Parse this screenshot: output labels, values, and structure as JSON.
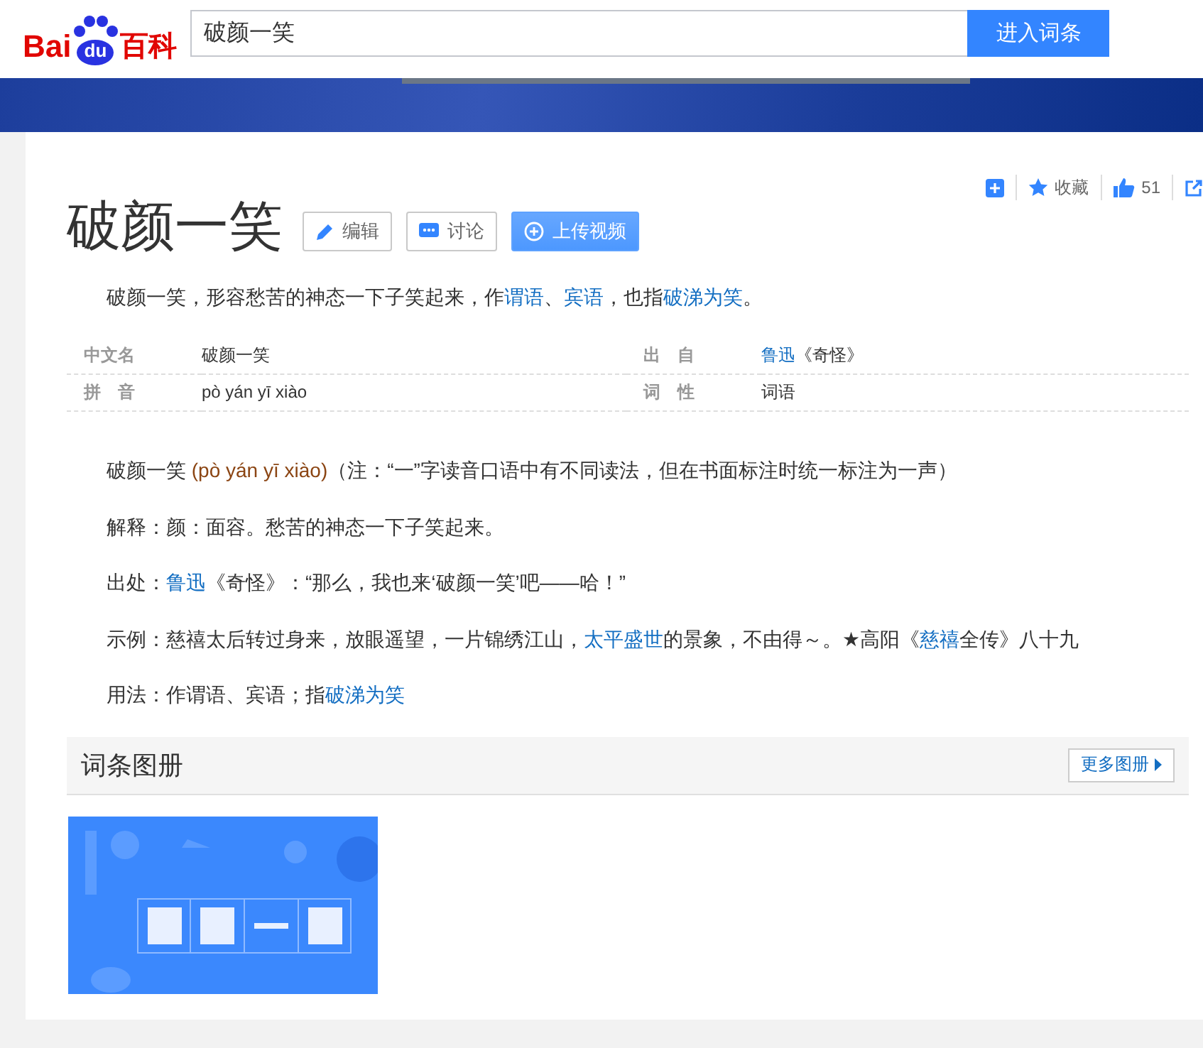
{
  "header": {
    "logo": {
      "latin": "Bai",
      "paw": "du",
      "cjk": "百科"
    },
    "search": {
      "value": "破颜一笑"
    },
    "search_button": "进入词条"
  },
  "toolbar": {
    "favorite": "收藏",
    "likes": "51"
  },
  "title": "破颜一笑",
  "title_buttons": [
    {
      "kind": "edit",
      "label": "编辑"
    },
    {
      "kind": "discuss",
      "label": "讨论"
    },
    {
      "kind": "upload",
      "label": "上传视频"
    }
  ],
  "summary": [
    {
      "kind": "plain",
      "text": "破颜一笑，形容愁苦的神态一下子笑起来，作"
    },
    {
      "kind": "link",
      "text": "谓语"
    },
    {
      "kind": "plain",
      "text": "、"
    },
    {
      "kind": "link",
      "text": "宾语"
    },
    {
      "kind": "plain",
      "text": "，也指"
    },
    {
      "kind": "link",
      "text": "破涕为笑"
    },
    {
      "kind": "plain",
      "text": "。"
    }
  ],
  "basic_info": [
    {
      "label": "中文名",
      "value": [
        {
          "kind": "plain",
          "text": "破颜一笑"
        }
      ]
    },
    {
      "label": "出　自",
      "value": [
        {
          "kind": "link",
          "text": "鲁迅"
        },
        {
          "kind": "plain",
          "text": "《奇怪》"
        }
      ]
    },
    {
      "label": "拼　音",
      "value": [
        {
          "kind": "plain",
          "text": "pò yán yī xiào"
        }
      ]
    },
    {
      "label": "词　性",
      "value": [
        {
          "kind": "plain",
          "text": "词语"
        }
      ]
    }
  ],
  "paragraphs": [
    [
      {
        "kind": "plain",
        "text": "破颜一笑 "
      },
      {
        "kind": "pinyin",
        "text": "(pò yán yī xiào)"
      },
      {
        "kind": "plain",
        "text": "（注：“一”字读音口语中有不同读法，但在书面标注时统一标注为一声）"
      }
    ],
    [
      {
        "kind": "plain",
        "text": "解释：颜：面容。愁苦的神态一下子笑起来。"
      }
    ],
    [
      {
        "kind": "plain",
        "text": "出处："
      },
      {
        "kind": "link",
        "text": "鲁迅"
      },
      {
        "kind": "plain",
        "text": "《奇怪》：“那么，我也来‘破颜一笑’吧——哈！”"
      }
    ],
    [
      {
        "kind": "plain",
        "text": "示例：慈禧太后转过身来，放眼遥望，一片锦绣江山，"
      },
      {
        "kind": "link",
        "text": "太平盛世"
      },
      {
        "kind": "plain",
        "text": "的景象，不由得～。★高阳《"
      },
      {
        "kind": "link",
        "text": "慈禧"
      },
      {
        "kind": "plain",
        "text": "全传》八十九"
      }
    ],
    [
      {
        "kind": "plain",
        "text": "用法：作谓语、宾语；指"
      },
      {
        "kind": "link",
        "text": "破涕为笑"
      }
    ]
  ],
  "album": {
    "title": "词条图册",
    "more": "更多图册"
  }
}
